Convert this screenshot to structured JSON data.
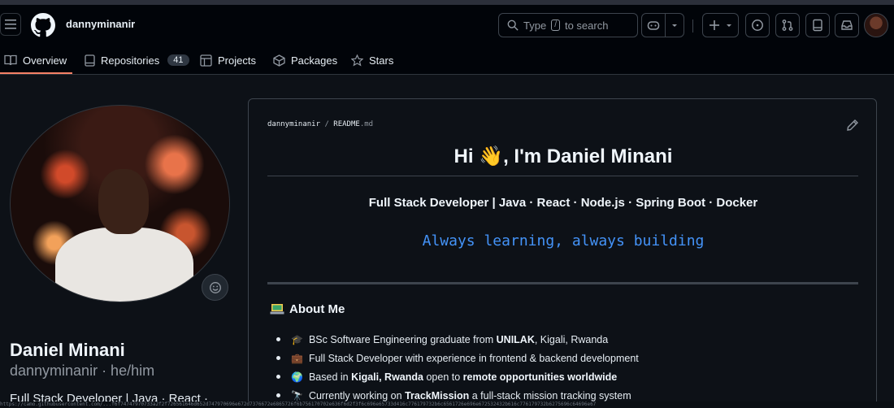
{
  "header": {
    "username": "dannyminanir",
    "search": {
      "prefix": "Type",
      "key": "/",
      "suffix": "to search"
    }
  },
  "tabs": [
    {
      "label": "Overview",
      "icon": "book-icon",
      "active": true
    },
    {
      "label": "Repositories",
      "icon": "repo-icon",
      "count": "41"
    },
    {
      "label": "Projects",
      "icon": "table-icon"
    },
    {
      "label": "Packages",
      "icon": "package-icon"
    },
    {
      "label": "Stars",
      "icon": "star-icon"
    }
  ],
  "profile": {
    "name": "Daniel Minani",
    "login_line": "dannyminanir · he/him",
    "bio": "Full Stack Developer | Java · React ·"
  },
  "readme": {
    "path_owner": "dannyminanir",
    "path_sep": "/",
    "path_file": "README",
    "path_ext": ".md",
    "heading": "Hi 👋, I'm Daniel Minani",
    "tagline": "Full Stack Developer | Java · React · Node.js · Spring Boot · Docker",
    "typing": "Always learning, always building",
    "about_title": "About Me",
    "about_items": [
      {
        "emoji": "🎓",
        "pre": "BSc Software Engineering graduate from ",
        "bold": "UNILAK",
        "post": ", Kigali, Rwanda"
      },
      {
        "emoji": "💼",
        "pre": "Full Stack Developer with experience in frontend & backend development",
        "bold": "",
        "post": ""
      },
      {
        "emoji": "🌍",
        "pre": "Based in ",
        "bold": "Kigali, Rwanda",
        "post": " open to ",
        "bold2": "remote opportunities worldwide"
      },
      {
        "emoji": "🔭",
        "pre": "Currently working on ",
        "bold": "TrackMission",
        "post": " a full-stack mission tracking system"
      }
    ]
  },
  "footer_strip": "https://camo.githubusercontent.com/...f6f74747970733a2f2f726561646d652d747970696e672d7376672e6865726f6b756170702e636f6d2f3f6c696e65733d416c776179732b6c6561726e696e672532432b616c776179732b6275696c64696e67"
}
